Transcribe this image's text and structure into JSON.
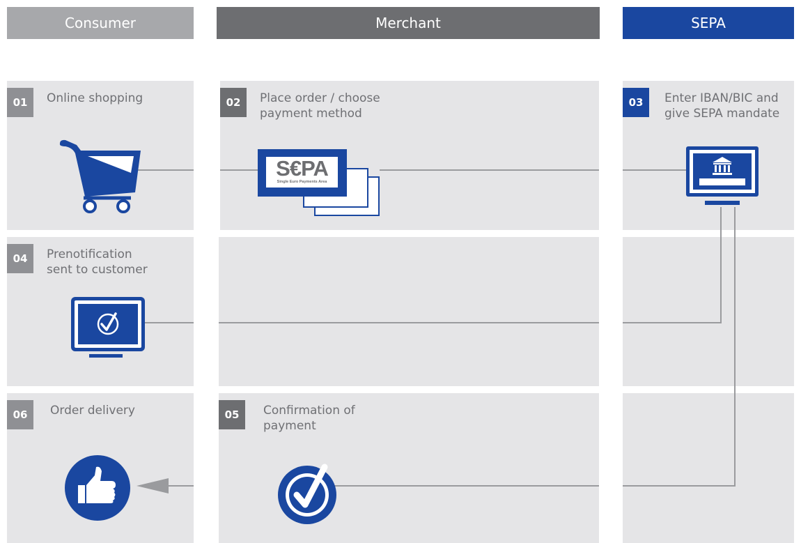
{
  "headers": {
    "consumer": "Consumer",
    "merchant": "Merchant",
    "sepa": "SEPA"
  },
  "steps": [
    {
      "number": "01",
      "label": "Online shopping"
    },
    {
      "number": "02",
      "label": "Place order / choose\npayment method"
    },
    {
      "number": "03",
      "label": "Enter IBAN/BIC and\ngive SEPA mandate"
    },
    {
      "number": "04",
      "label": "Prenotification\nsent to customer"
    },
    {
      "number": "05",
      "label": "Confirmation of\npayment"
    },
    {
      "number": "06",
      "label": "Order delivery"
    }
  ],
  "sepa_logo": {
    "text": "S€PA",
    "subtitle": "Single Euro Payments Area"
  },
  "colors": {
    "consumer_header": "#a7a8ab",
    "merchant_header": "#6d6e71",
    "sepa_header": "#1a47a0",
    "cell_bg": "#e5e5e7",
    "number_gray": "#8f9094",
    "number_blue": "#1a47a0",
    "icon_blue": "#1a47a0",
    "line_gray": "#9a9b9e"
  },
  "icons": {
    "cart": "shopping-cart-icon",
    "sepa_cards": "sepa-cards-icon",
    "bank_monitor": "bank-monitor-icon",
    "check_monitor": "checkmark-monitor-icon",
    "thumbs_up": "thumbs-up-icon",
    "check_circle": "checkmark-circle-icon"
  }
}
